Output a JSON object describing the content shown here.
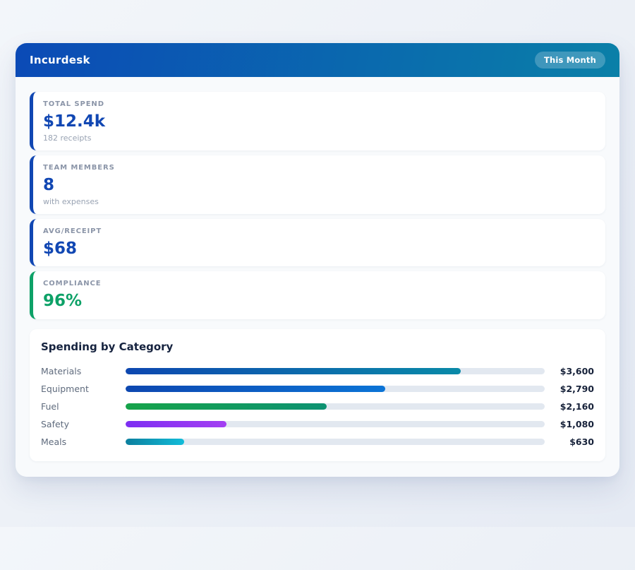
{
  "header": {
    "app_title": "Incurdesk",
    "badge_label": "This Month",
    "gradient_from": "#0b4ab6",
    "gradient_to": "#0a80a8"
  },
  "stats": [
    {
      "label": "TOTAL SPEND",
      "value": "$12.4k",
      "sub": "182 receipts",
      "accent": "#1147b3"
    },
    {
      "label": "TEAM MEMBERS",
      "value": "8",
      "sub": "with expenses",
      "accent": "#1147b3"
    },
    {
      "label": "AVG/RECEIPT",
      "value": "$68",
      "accent": "#1147b3"
    },
    {
      "label": "COMPLIANCE",
      "value": "96%",
      "accent": "#0da167"
    }
  ],
  "chart_data": {
    "type": "bar",
    "orientation": "horizontal",
    "title": "Spending by Category",
    "categories": [
      "Materials",
      "Equipment",
      "Fuel",
      "Safety",
      "Meals"
    ],
    "values": [
      3600,
      2790,
      2160,
      1080,
      630
    ],
    "value_labels": [
      "$3,600",
      "$2,790",
      "$2,160",
      "$1,080",
      "$630"
    ],
    "xlabel": "",
    "ylabel": "",
    "xlim": [
      0,
      4500
    ],
    "grid": false,
    "legend": false,
    "track_color": "#e2e8f0",
    "bar_gradients": [
      [
        "#0d47b0",
        "#0a8aa8"
      ],
      [
        "#0d47b0",
        "#0b74d6"
      ],
      [
        "#16a34a",
        "#0d9272"
      ],
      [
        "#7d2ef2",
        "#a33ff2"
      ],
      [
        "#0c7f9e",
        "#12bcd9"
      ]
    ]
  }
}
